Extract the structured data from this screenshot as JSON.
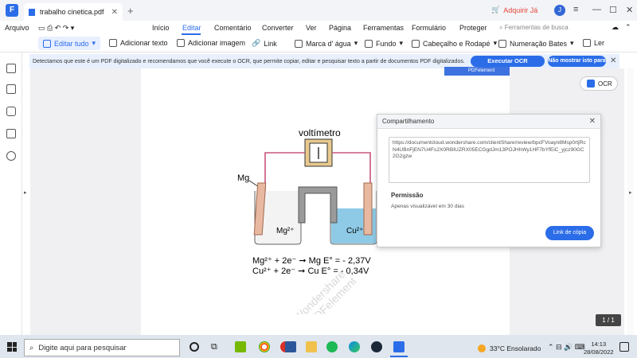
{
  "window": {
    "tab_title": "trabalho cinetica.pdf",
    "buy_label": "Adquirir Já",
    "avatar": "J"
  },
  "menu": {
    "file": "Arquivo",
    "items": [
      "Início",
      "Editar",
      "Comentário",
      "Converter",
      "Ver",
      "Página",
      "Ferramentas",
      "Formulário",
      "Proteger"
    ],
    "search_tools": "Ferramentas de busca"
  },
  "toolbar": {
    "edit_all": "Editar tudo",
    "add_text": "Adicionar texto",
    "add_image": "Adicionar imagem",
    "link": "Link",
    "watermark": "Marca d' água",
    "background": "Fundo",
    "header_footer": "Cabeçalho e Rodapé",
    "bates": "Numeração Bates",
    "read": "Ler"
  },
  "ocr_bar": {
    "message": "Detectamos que este é um PDF digitalizado e recomendamos que você execute o OCR, que permite copiar, editar e pesquisar texto a partir de documentos PDF digitalizados.",
    "run": "Executar OCR",
    "hide": "Não mostrar isto para"
  },
  "ocr_button": "OCR",
  "pdfelement_tag": "PDFelement",
  "figure": {
    "meter": "voltímetro",
    "mg": "Mg",
    "mg_ion": "Mg²⁺",
    "cu_ion": "Cu²⁺",
    "eq1": "Mg²⁺ + 2e⁻  ➞ Mg E° = - 2,37V",
    "eq2": "Cu²⁺ + 2e⁻  ➞ Cu  E° = - 0,34V",
    "watermark1": "Wondershare",
    "watermark2": "PDFelement"
  },
  "dialog": {
    "title": "Compartilhamento",
    "url": "https://documentcloud.wondershare.com/clientShare/review/bpcFVoayn8Msp0rtjRcN4UBnFjEN7U4Fs2X0RBIUZRX05ECGgdJm13POJHhWy1HF7bYfEiC_yjcz90GC2G2gzw",
    "permission_title": "Permissão",
    "permission_text": "Apenas visualizável em 30 dias",
    "copy_link": "Link de cópia"
  },
  "page_indicator": "1 / 1",
  "taskbar": {
    "search_placeholder": "Digite aqui para pesquisar",
    "weather": "33°C  Ensolarado",
    "time": "14:13",
    "date": "28/08/2022"
  }
}
